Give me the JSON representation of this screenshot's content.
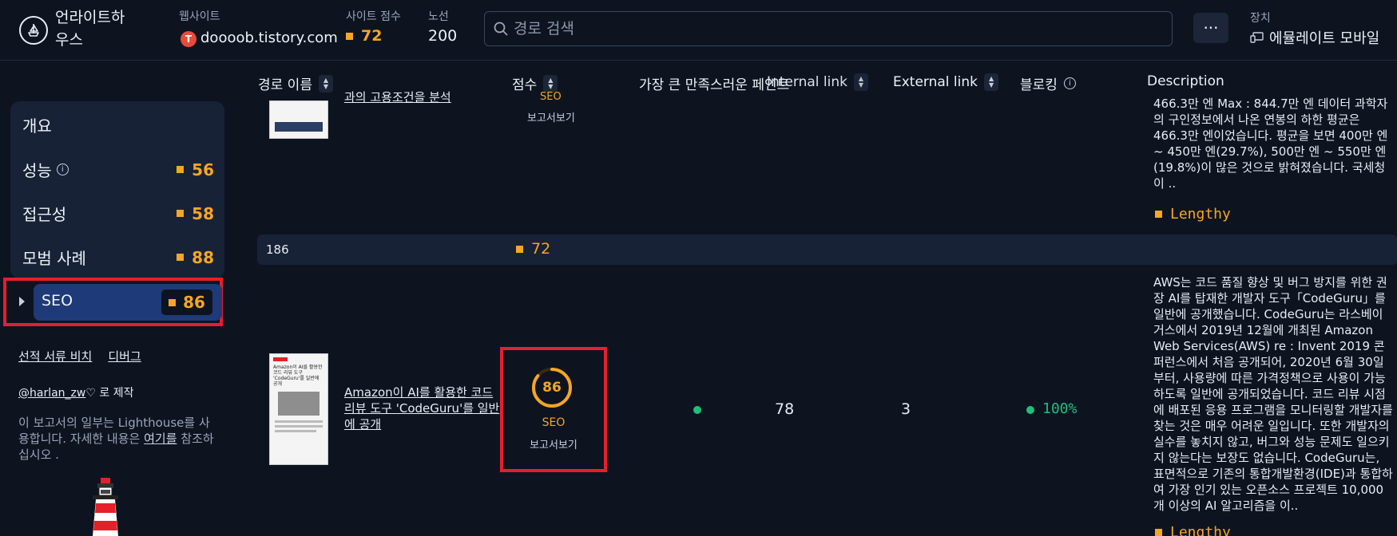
{
  "header": {
    "brand_line1": "언라이트하",
    "brand_line2": "우스",
    "website_label": "웹사이트",
    "website_icon_letter": "T",
    "website_value": "doooob.tistory.com",
    "site_score_label": "사이트 점수",
    "site_score_value": "72",
    "routes_label": "노선",
    "routes_value": "200",
    "search_placeholder": "경로 검색",
    "more_label": "···",
    "device_label": "장치",
    "device_value": "에뮬레이트 모바일"
  },
  "sidebar": {
    "overview": "개요",
    "items": [
      {
        "label": "성능",
        "score": "56",
        "has_info": true
      },
      {
        "label": "접근성",
        "score": "58",
        "has_info": false
      },
      {
        "label": "모범 사례",
        "score": "88",
        "has_info": false
      }
    ],
    "seo_label": "SEO",
    "seo_score": "86",
    "link_selected_docs": "선적 서류 비치",
    "link_debug": "디버그",
    "made_by_handle": "@harlan_zw",
    "made_by_suffix": "로 제작",
    "note_text": "이 보고서의 일부는 Lighthouse를 사용합니다. 자세한 내용은",
    "note_link": "여기를",
    "note_suffix": "참조하십시오 ."
  },
  "table": {
    "headers": {
      "route_name": "경로 이름",
      "score": "점수",
      "largest_contentful_paint": "가장 큰 만족스러운 페인트",
      "internal_link": "Internal link",
      "external_link": "External link",
      "blocking": "블로킹",
      "description": "Description"
    },
    "prev_row": {
      "title_fragment": "과의 고용조건을 분석",
      "score_label": "SEO",
      "report_link": "보고서보기",
      "description": "466.3만 엔 Max : 844.7만 엔 데이터 과학자의 구인정보에서 나온 연봉의 하한 평균은 466.3만 엔이었습니다. 평균을 보면 400만 엔 ~ 450만 엔(29.7%), 500만 엔 ~ 550만 엔(19.8%)이 많은 것으로 밝혀졌습니다. 국세청이 ..",
      "desc_badge": "Lengthy"
    },
    "group_row": {
      "count": "186",
      "score": "72"
    },
    "row": {
      "title": "Amazon이 AI를 활용한 코드 리뷰 도구 'CodeGuru'를 일반에 공개",
      "score": "86",
      "score_label": "SEO",
      "report_link": "보고서보기",
      "internal_link": "78",
      "external_link": "3",
      "blocking": "100%",
      "description": "AWS는 코드 품질 향상 및 버그 방지를 위한 권장 AI를 탑재한 개발자 도구「CodeGuru」를 일반에 공개했습니다. CodeGuru는 라스베이거스에서 2019년 12월에 개최된 Amazon Web Services(AWS) re : Invent 2019 콘퍼런스에서 처음 공개되어, 2020년 6월 30일부터, 사용량에 따른 가격정책으로 사용이 가능하도록 일반에 공개되었습니다. 코드 리뷰 시점에 배포된 응용 프로그램을 모니터링할 개발자를 찾는 것은 매우 어려운 일입니다. 또한 개발자의 실수를 놓치지 않고, 버그와 성능 문제도 일으키지 않는다는 보장도 없습니다. CodeGuru는, 표면적으로 기존의 통합개발환경(IDE)과 통합하여 가장 인기 있는 오픈소스 프로젝트 10,000개 이상의 AI 알고리즘을 이..",
      "desc_badge": "Lengthy",
      "thumb_heading": "Amazon이 AI를 활용한 코드 리뷰 도구 'CodeGuru'를 일반에 공개"
    }
  },
  "colors": {
    "accent_orange": "#f6a623",
    "highlight_red": "#e4202a",
    "good_green": "#1fbf7a",
    "seo_blue": "#1f3a78"
  },
  "icons": [
    "lighthouse-logo-icon",
    "search-icon",
    "more-icon",
    "device-icon",
    "info-icon",
    "sort-icon",
    "heart-icon",
    "caret-right-icon"
  ]
}
